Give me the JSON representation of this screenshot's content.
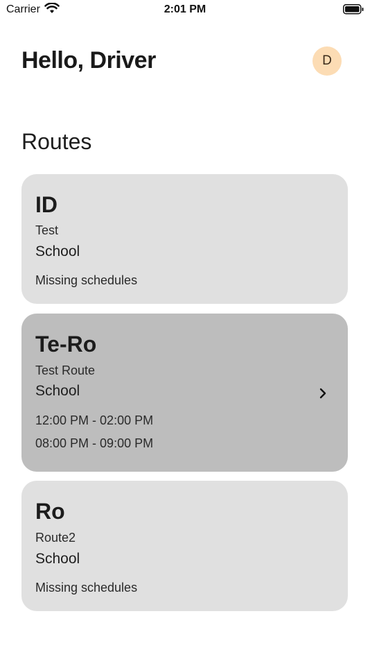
{
  "status_bar": {
    "carrier": "Carrier",
    "time": "2:01 PM",
    "wifi_icon": "wifi-icon",
    "battery_icon": "battery-icon"
  },
  "header": {
    "greeting": "Hello, Driver",
    "avatar_initial": "D",
    "avatar_color": "#fcdcb4"
  },
  "section_title": "Routes",
  "routes": [
    {
      "code": "ID",
      "name": "Test",
      "type": "School",
      "status": "Missing schedules"
    },
    {
      "code": "Te-Ro",
      "name": "Test Route",
      "type": "School",
      "schedules": [
        "12:00 PM - 02:00 PM",
        "08:00 PM - 09:00 PM"
      ],
      "selected": true,
      "icon": "chevron-right-icon"
    },
    {
      "code": "Ro",
      "name": "Route2",
      "type": "School",
      "status": "Missing schedules"
    }
  ],
  "colors": {
    "card_background": "#e0e0e0",
    "card_selected_background": "#bdbdbd",
    "text_primary": "#1c1c1c"
  }
}
